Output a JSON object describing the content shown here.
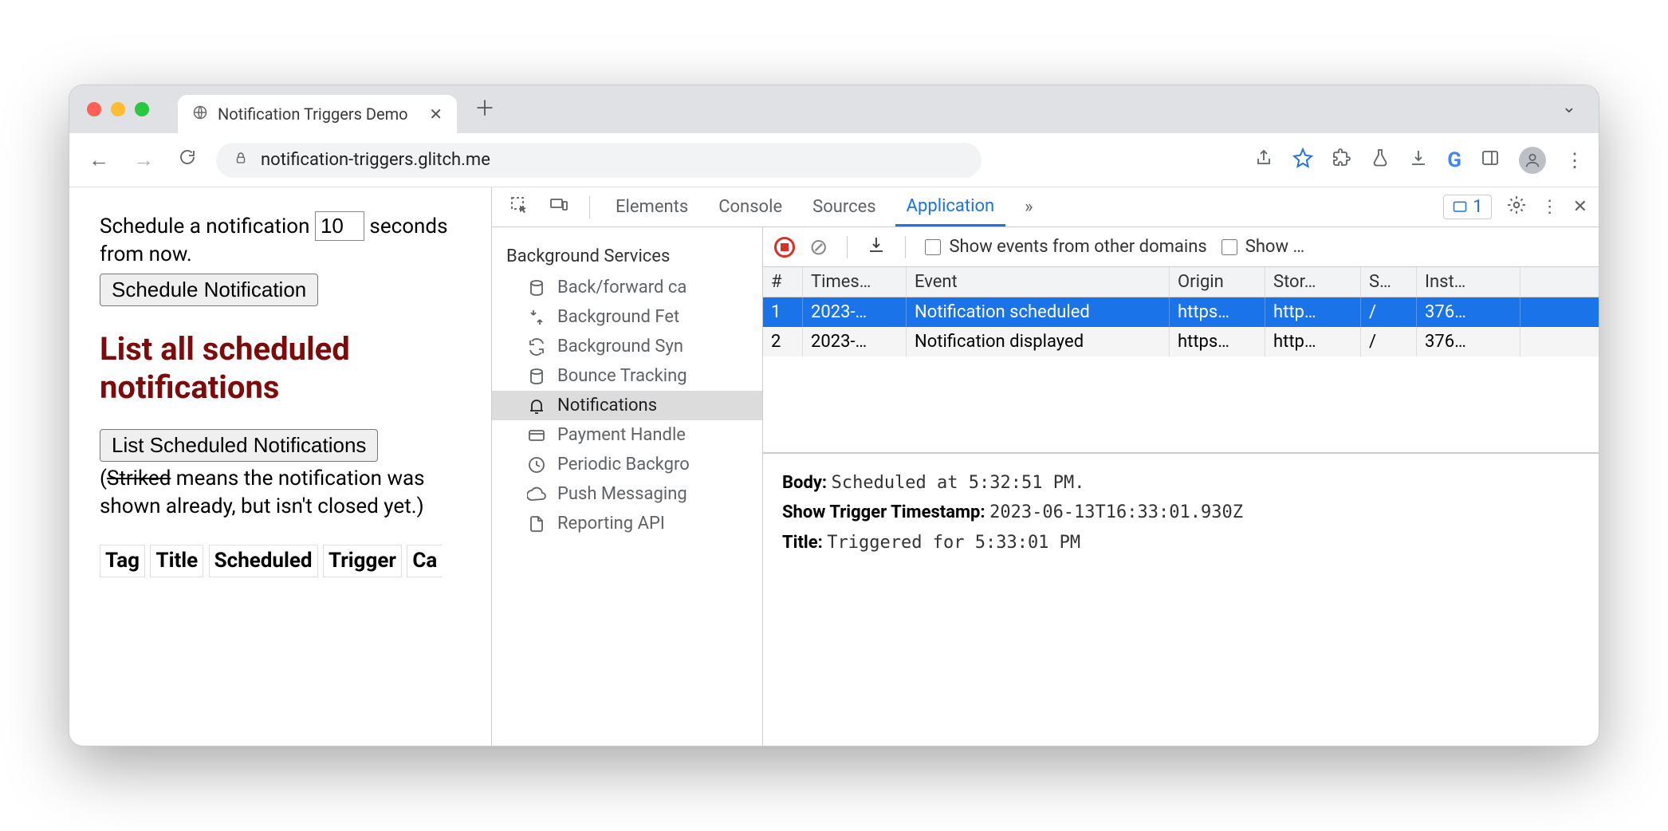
{
  "tab": {
    "title": "Notification Triggers Demo"
  },
  "urlbar": {
    "domain": "notification-triggers.glitch.me"
  },
  "page": {
    "schedule_text_a": "Schedule a notification ",
    "schedule_input": "10",
    "schedule_text_b": " seconds from now.",
    "schedule_button": "Schedule Notification",
    "heading": "List all scheduled notifications",
    "list_button": "List Scheduled Notifications",
    "note_open": "(",
    "note_strike": "Striked",
    "note_rest": " means the notification was shown already, but isn't closed yet.)",
    "th": [
      "Tag",
      "Title",
      "Scheduled",
      "Trigger",
      "Ca"
    ]
  },
  "devtools": {
    "tabs": [
      "Elements",
      "Console",
      "Sources",
      "Application"
    ],
    "active_tab": "Application",
    "more_tabs": "»",
    "issues_count": "1",
    "sidebar_heading": "Background Services",
    "sidebar_items": [
      "Back/forward ca",
      "Background Fet",
      "Background Syn",
      "Bounce Tracking",
      "Notifications",
      "Payment Handle",
      "Periodic Backgro",
      "Push Messaging",
      "Reporting API"
    ],
    "sidebar_selected": 4,
    "events_toolbar": {
      "chk1": "Show events from other domains",
      "chk2": "Show …"
    },
    "events_head": [
      "#",
      "Times…",
      "Event",
      "Origin",
      "Stor…",
      "S…",
      "Inst…"
    ],
    "events_rows": [
      {
        "cells": [
          "1",
          "2023-…",
          "Notification scheduled",
          "https…",
          "http…",
          "/",
          "376…"
        ],
        "selected": true
      },
      {
        "cells": [
          "2",
          "2023-…",
          "Notification displayed",
          "https…",
          "http…",
          "/",
          "376…"
        ],
        "selected": false
      }
    ],
    "detail": {
      "body_k": "Body:",
      "body_v": "Scheduled at 5:32:51 PM.",
      "ts_k": "Show Trigger Timestamp:",
      "ts_v": "2023-06-13T16:33:01.930Z",
      "title_k": "Title:",
      "title_v": "Triggered for 5:33:01 PM"
    }
  }
}
